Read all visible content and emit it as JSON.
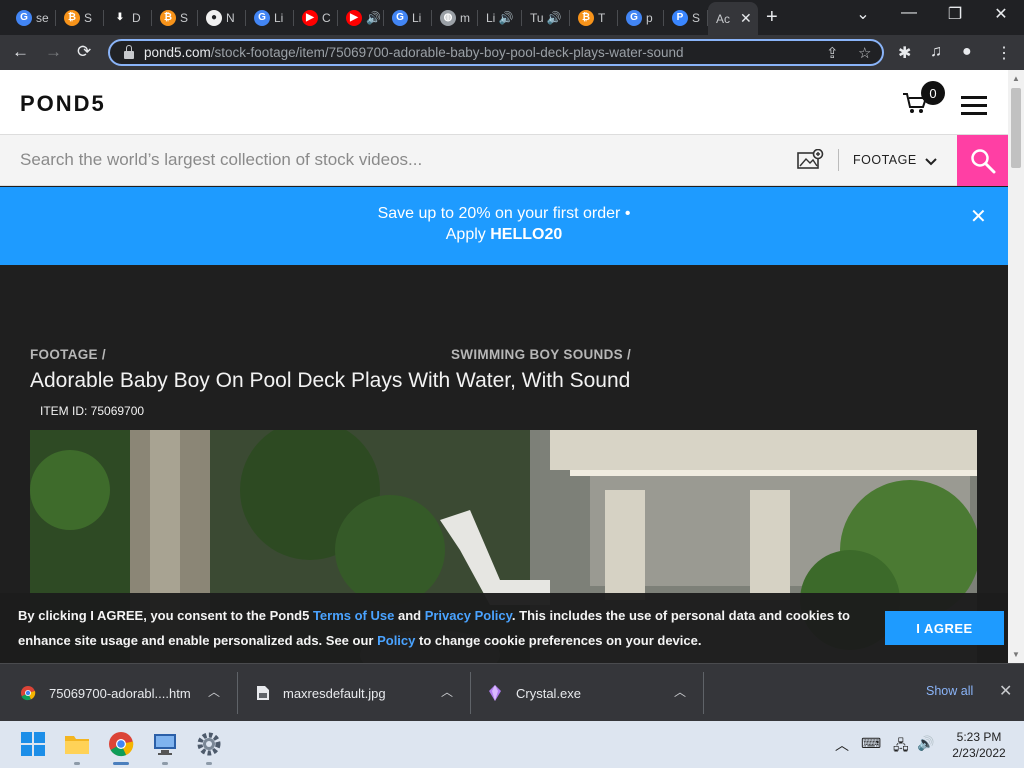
{
  "browser": {
    "tabs": [
      {
        "title": "se",
        "favicon_icon": "google-icon",
        "fav_color": "#4285f4",
        "fav_letter": "G"
      },
      {
        "title": "S",
        "favicon_icon": "bitcoin-icon",
        "fav_color": "#f7931a",
        "fav_letter": "₿"
      },
      {
        "title": "D",
        "favicon_icon": "download-icon",
        "fav_color": "#202124",
        "fav_letter": "⬇"
      },
      {
        "title": "S",
        "favicon_icon": "bitcoin-icon",
        "fav_color": "#f7931a",
        "fav_letter": "₿"
      },
      {
        "title": "N",
        "favicon_icon": "github-icon",
        "fav_color": "#f0f0f0",
        "fav_letter": "●"
      },
      {
        "title": "Li",
        "favicon_icon": "google-icon",
        "fav_color": "#4285f4",
        "fav_letter": "G"
      },
      {
        "title": "C",
        "favicon_icon": "youtube-icon",
        "fav_color": "#ff0000",
        "fav_letter": "▶"
      },
      {
        "title": "🔊",
        "favicon_icon": "youtube-icon",
        "fav_color": "#ff0000",
        "fav_letter": "▶"
      },
      {
        "title": "Li",
        "favicon_icon": "google-icon",
        "fav_color": "#4285f4",
        "fav_letter": "G"
      },
      {
        "title": "m",
        "favicon_icon": "globe-icon",
        "fav_color": "#9aa0a6",
        "fav_letter": "◍"
      },
      {
        "title": "Li 🔊",
        "favicon_icon": "none",
        "fav_color": "",
        "fav_letter": ""
      },
      {
        "title": "Tu 🔊",
        "favicon_icon": "none",
        "fav_color": "",
        "fav_letter": ""
      },
      {
        "title": "T",
        "favicon_icon": "bitcoin-icon",
        "fav_color": "#f7931a",
        "fav_letter": "₿"
      },
      {
        "title": "p",
        "favicon_icon": "google-icon",
        "fav_color": "#4285f4",
        "fav_letter": "G"
      },
      {
        "title": "S",
        "favicon_icon": "pond5-icon",
        "fav_color": "#3a86ff",
        "fav_letter": "P"
      },
      {
        "title": "Ac",
        "favicon_icon": "none",
        "fav_color": "",
        "fav_letter": "",
        "active": true
      }
    ],
    "url_host": "pond5.com",
    "url_path": "/stock-footage/item/75069700-adorable-baby-boy-pool-deck-plays-water-sound"
  },
  "site": {
    "logo": "POND5",
    "cart_count": "0",
    "search_placeholder": "Search the world’s largest collection of stock videos...",
    "search_type": "FOOTAGE",
    "promo_line1": "Save up to 20% on your first order •",
    "promo_apply": "Apply ",
    "promo_code": "HELLO20",
    "close_symbol": "✕"
  },
  "item": {
    "breadcrumb_1": "FOOTAGE /",
    "breadcrumb_2": "SWIMMING BOY SOUNDS /",
    "title": "Adorable Baby Boy On Pool Deck Plays With Water, With Sound",
    "item_id": "ITEM ID: 75069700"
  },
  "cookie": {
    "text_1": "By clicking I AGREE, you consent to the Pond5 ",
    "terms_link": "Terms of Use",
    "text_2": " and ",
    "privacy_link": "Privacy Policy",
    "text_3": ". This includes the use of personal data and cookies to enhance site usage and enable personalized ads. See our ",
    "policy_link": "Policy",
    "text_4": " to change cookie preferences on your device.",
    "agree_label": "I AGREE"
  },
  "downloads": {
    "items": [
      {
        "name": "75069700-adorabl....htm",
        "icon": "chrome-icon"
      },
      {
        "name": "maxresdefault.jpg",
        "icon": "file-icon"
      },
      {
        "name": "Crystal.exe",
        "icon": "crystal-icon"
      }
    ],
    "show_all": "Show all"
  },
  "taskbar": {
    "time": "5:23 PM",
    "date": "2/23/2022"
  }
}
